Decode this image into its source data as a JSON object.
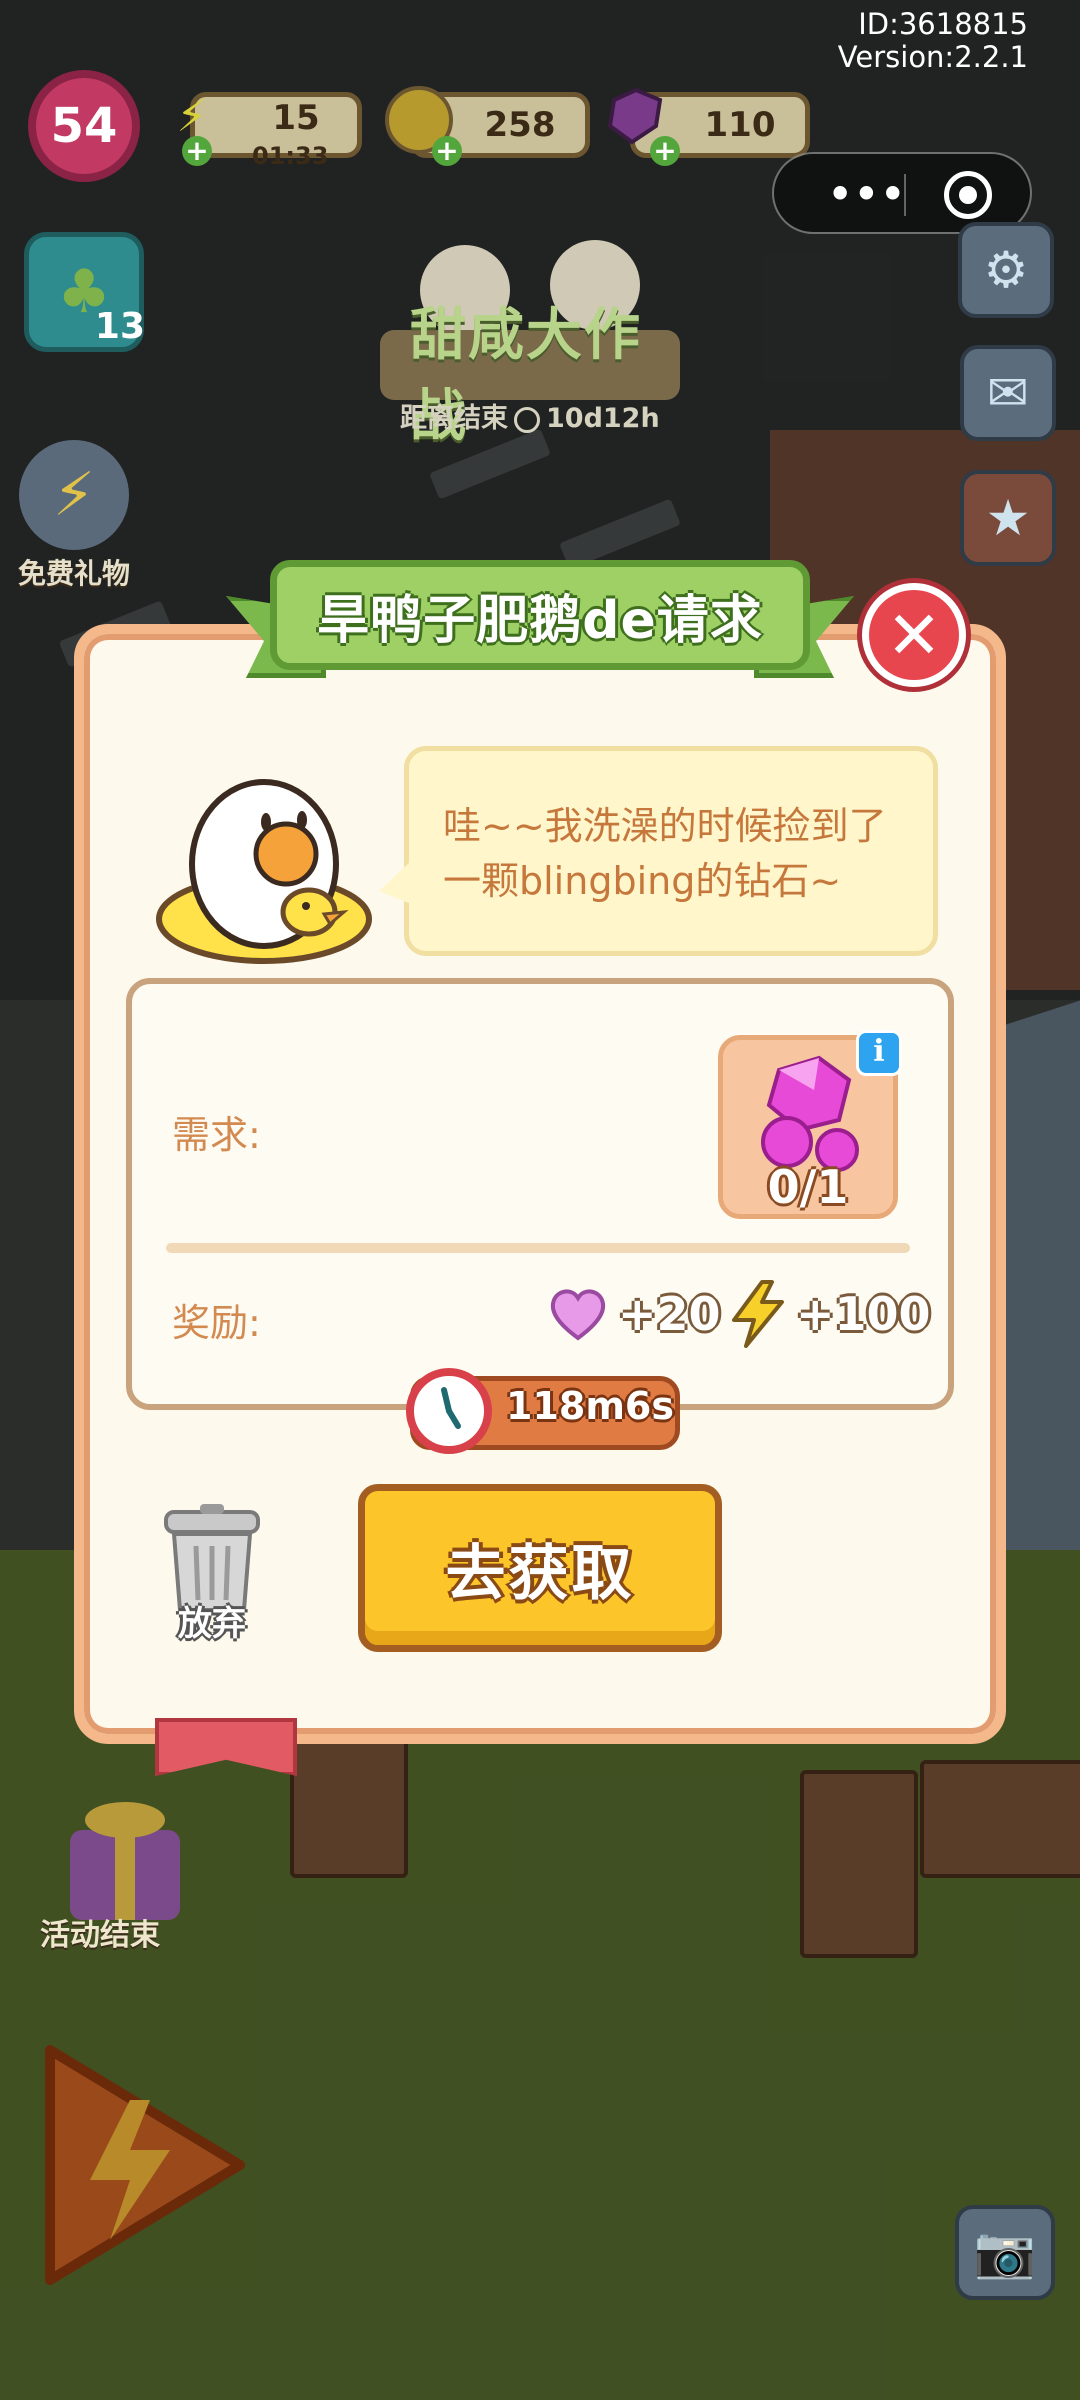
{
  "account": {
    "id_text": "ID:3618815",
    "version_text": "Version:2.2.1"
  },
  "hud": {
    "level": "54",
    "energy": "15",
    "energy_timer": "01:33",
    "coins": "258",
    "gems": "110",
    "clover_count": "13",
    "free_gift_label": "免费礼物"
  },
  "event_banner": {
    "title": "甜咸大作战",
    "countdown_label": "距离结束",
    "countdown_value": "10d12h"
  },
  "bottom_left": {
    "event_end_label": "活动结束"
  },
  "dialog": {
    "title": "旱鸭子肥鹅de请求",
    "speech": "哇~~我洗澡的时候捡到了一颗blingbing的钻石~",
    "requirement_label": "需求:",
    "requirement_item_icon": "pink-gem",
    "requirement_progress": "0/1",
    "reward_label": "奖励:",
    "rewards": [
      {
        "icon": "heart",
        "value": "+20"
      },
      {
        "icon": "lightning",
        "value": "+100"
      }
    ],
    "timer": "118m6s",
    "abandon_label": "放弃",
    "go_button_label": "去获取"
  },
  "colors": {
    "dialog_bg": "#fdf9ec",
    "dialog_border": "#f5b88b",
    "title_green": "#9fd066",
    "close_red": "#e8464f",
    "go_yellow": "#fcc62a",
    "label_orange": "#d38a50"
  }
}
